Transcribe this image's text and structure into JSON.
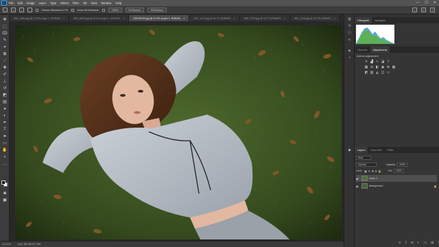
{
  "app": {
    "logo": "Ps"
  },
  "menu": [
    "File",
    "Edit",
    "Image",
    "Layer",
    "Type",
    "Select",
    "Filter",
    "3D",
    "View",
    "Window",
    "Help"
  ],
  "window_controls": [
    "—",
    "☐",
    "✕"
  ],
  "options_bar": {
    "resize_label": "Resize Windows to Fit",
    "zoom_all_label": "Zoom All Windows",
    "zoom_value": "100%",
    "fit_screen": "Fit Screen",
    "fill_screen": "Fill Screen"
  },
  "tabs": [
    {
      "label": "IMG_1864.jpg @ 21.5% (Layer 1, RGB/8*)",
      "active": false
    },
    {
      "label": "IMG_8818.jpg @ 21.5% (Layer 1, RGB/8*)",
      "active": false
    },
    {
      "label": "DSC05103.jpg @ 21.5% (Layer 1, RGB/8*)",
      "active": true
    },
    {
      "label": "IMG_1477.jpg @ 16.7% (RGB/8*)",
      "active": false
    },
    {
      "label": "IMG_7329.jpg @ 16.7% (RGB/8*)",
      "active": false
    },
    {
      "label": "IMG_9159.jpg @ 16.7% (RGB/8*)",
      "active": false
    }
  ],
  "status": {
    "zoom": "21.67%",
    "doc_size": "Doc: 68.7M/137.3M"
  },
  "histogram_panel": {
    "tabs": [
      "Histogram",
      "Navigator"
    ]
  },
  "adjustments_panel": {
    "tabs": [
      "Libraries",
      "Adjustments"
    ],
    "hint": "Add an adjustment"
  },
  "layers_panel": {
    "tabs": [
      "Layers",
      "Channels",
      "Paths"
    ],
    "filter_kind": "Kind",
    "blend_mode": "Normal",
    "opacity_label": "Opacity:",
    "opacity_value": "100%",
    "lock_label": "Lock:",
    "fill_label": "Fill:",
    "fill_value": "100%",
    "layers": [
      {
        "name": "Layer 1",
        "selected": true
      },
      {
        "name": "Background",
        "selected": false
      }
    ]
  },
  "colors": {
    "accent": "#31a8ff",
    "panel_bg": "#353535",
    "grass": "#3f5a26",
    "sweater": "#b8bfc7"
  }
}
